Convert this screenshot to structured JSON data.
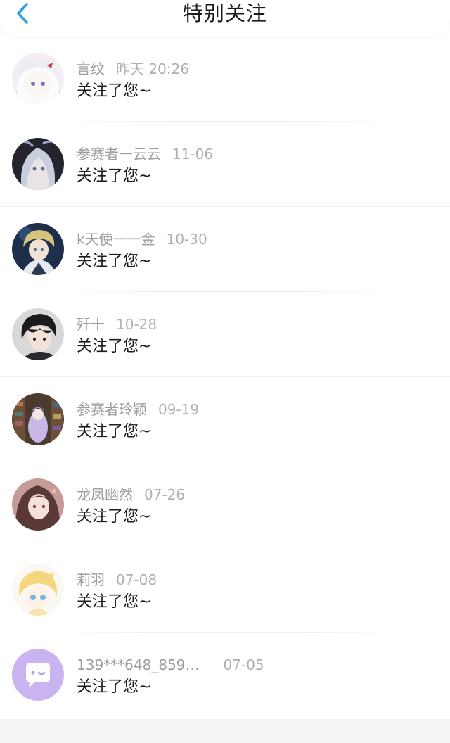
{
  "header": {
    "title": "特别关注",
    "back_icon": "chevron-left-icon",
    "accent_color": "#2a9ee8"
  },
  "items": [
    {
      "name": "言纹",
      "time": "昨天 20:26",
      "message": "关注了您~",
      "avatar_style": "white-hair-anime-girl"
    },
    {
      "name": "参赛者一云云",
      "time": "11-06",
      "message": "关注了您~",
      "avatar_style": "silver-hair-anime-boy"
    },
    {
      "name": "k天使一一金",
      "time": "10-30",
      "message": "关注了您~",
      "avatar_style": "blonde-anime-boy-dark-bg"
    },
    {
      "name": "歼十",
      "time": "10-28",
      "message": "关注了您~",
      "avatar_style": "black-hair-anime-boy"
    },
    {
      "name": "参赛者玲颖",
      "time": "09-19",
      "message": "关注了您~",
      "avatar_style": "library-anime-girl"
    },
    {
      "name": "龙凤幽然",
      "time": "07-26",
      "message": "关注了您~",
      "avatar_style": "brown-hair-anime-girl"
    },
    {
      "name": "莉羽",
      "time": "07-08",
      "message": "关注了您~",
      "avatar_style": "blonde-chibi"
    },
    {
      "name": "139***648_859…",
      "time": "07-05",
      "message": "关注了您~",
      "avatar_style": "default-chat-bubble"
    }
  ]
}
